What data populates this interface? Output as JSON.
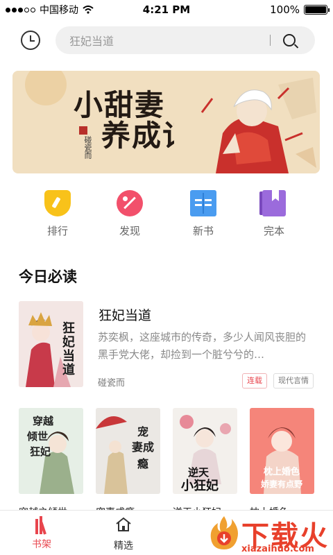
{
  "status_bar": {
    "carrier": "中国移动",
    "time": "4:21 PM",
    "battery": "100%",
    "battery_level": 1.0
  },
  "search": {
    "placeholder": "狂妃当道"
  },
  "banner": {
    "title_line1": "小甜妻",
    "title_line2": "养成记",
    "author": "碰瓷而"
  },
  "categories": [
    {
      "label": "排行",
      "icon": "trophy-icon"
    },
    {
      "label": "发现",
      "icon": "discover-icon"
    },
    {
      "label": "新书",
      "icon": "open-book-icon"
    },
    {
      "label": "完本",
      "icon": "bookmark-book-icon"
    }
  ],
  "today": {
    "title": "今日必读",
    "featured": {
      "title": "狂妃当道",
      "description": "苏奕枫，这座城市的传奇，多少人闻风丧胆的黑手党大佬，却捡到一个脏兮兮的…",
      "author": "碰瓷而",
      "tags": [
        "连载",
        "现代言情"
      ],
      "cover_text": "狂妃当道"
    },
    "books": [
      {
        "title": "穿越之倾世",
        "cover_text": "穿越之倾世狂妃"
      },
      {
        "title": "宠妻成瘾",
        "cover_text": "宠妻成瘾"
      },
      {
        "title": "逆天小狂妃",
        "cover_text": "逆天小狂妃"
      },
      {
        "title": "枕上婚色",
        "cover_text": "枕上婚色 娇妻有点野"
      }
    ]
  },
  "tabbar": {
    "shelf": "书架",
    "pick": "精选"
  },
  "watermark": {
    "text": "下载火",
    "url": "xiazaihuo.com"
  },
  "colors": {
    "accent": "#e8454d",
    "banner_bg": "#f1dfc0"
  }
}
